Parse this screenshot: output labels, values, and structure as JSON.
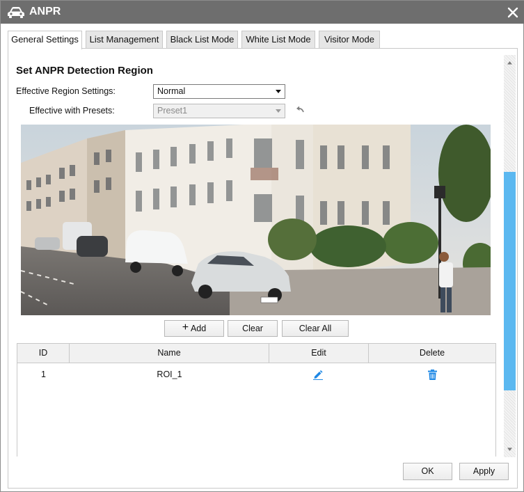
{
  "window": {
    "title": "ANPR"
  },
  "tabs": [
    {
      "label": "General Settings",
      "active": true
    },
    {
      "label": "List Management",
      "active": false
    },
    {
      "label": "Black List Mode",
      "active": false
    },
    {
      "label": "White List Mode",
      "active": false
    },
    {
      "label": "Visitor Mode",
      "active": false
    }
  ],
  "section": {
    "title": "Set ANPR Detection Region"
  },
  "form": {
    "region_label": "Effective Region Settings:",
    "region_value": "Normal",
    "presets_label": "Effective with Presets:",
    "presets_value": "Preset1"
  },
  "region_buttons": {
    "add": "Add",
    "clear": "Clear",
    "clear_all": "Clear All"
  },
  "table": {
    "headers": [
      "ID",
      "Name",
      "Edit",
      "Delete"
    ],
    "rows": [
      {
        "id": "1",
        "name": "ROI_1"
      }
    ]
  },
  "footer": {
    "ok": "OK",
    "apply": "Apply"
  },
  "colors": {
    "titlebar": "#6e6e6e",
    "accent": "#1e88e5",
    "scroll_thumb": "#5bb8f0"
  },
  "icons": {
    "title": "car-icon",
    "close": "close-icon",
    "undo": "undo-icon",
    "add": "plus-icon",
    "edit": "pencil-icon",
    "delete": "trash-icon"
  }
}
